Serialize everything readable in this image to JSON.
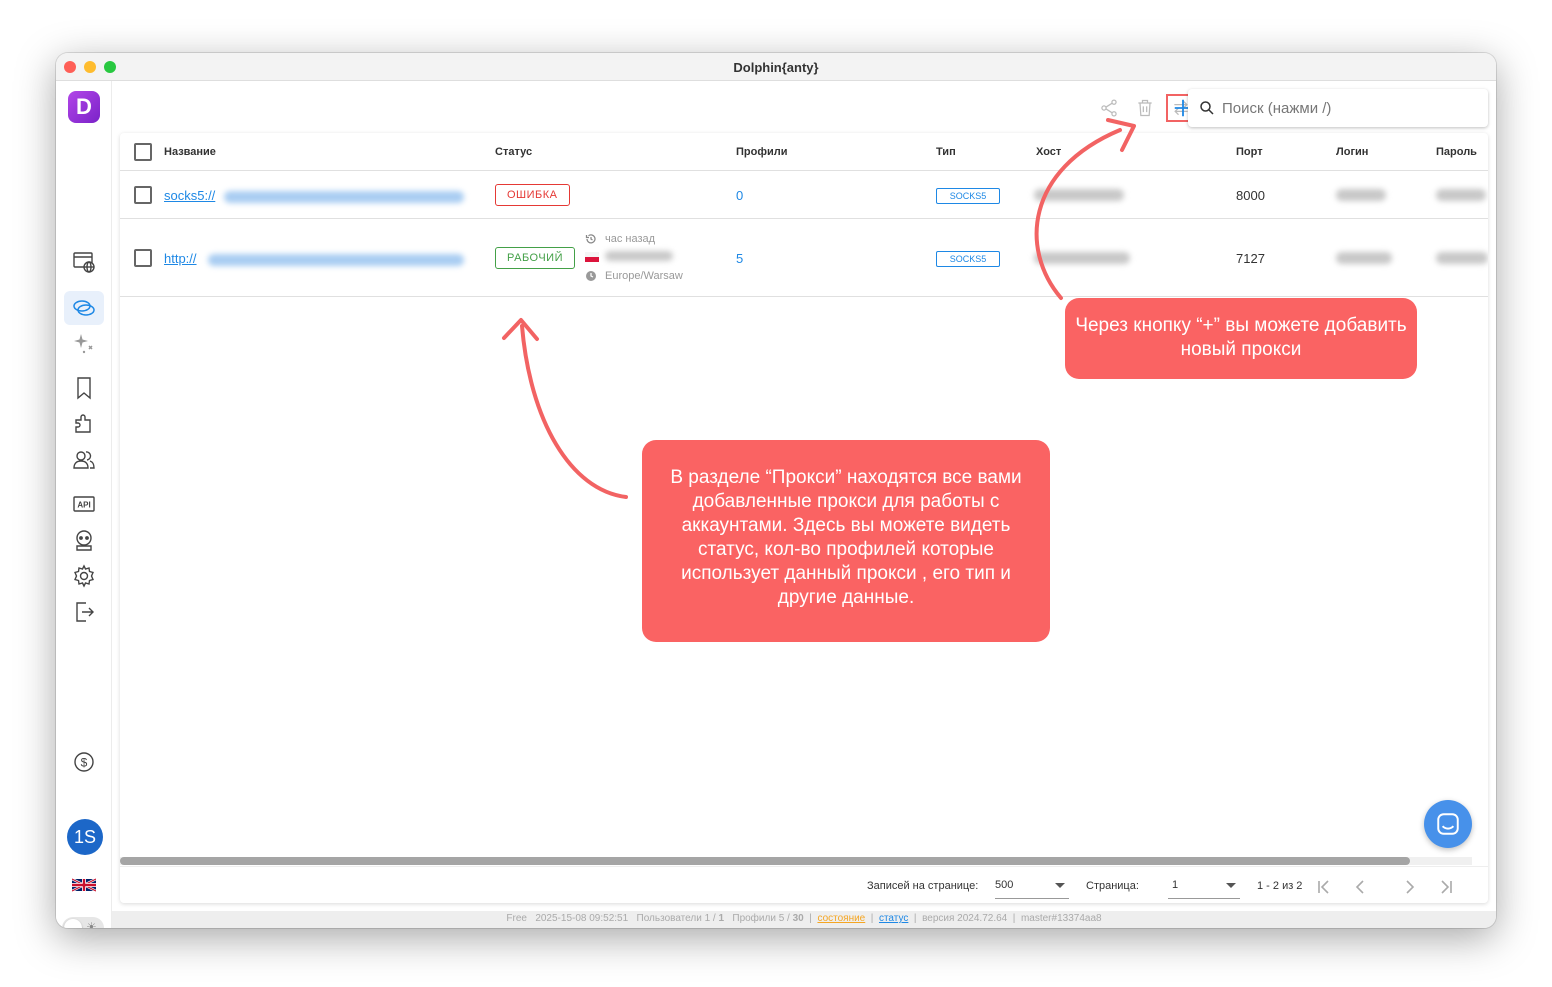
{
  "window": {
    "title": "Dolphin{anty}"
  },
  "sidebar": {
    "logo": "D",
    "avatar": "1S"
  },
  "search": {
    "placeholder": "Поиск (нажми /)"
  },
  "table": {
    "columns": [
      "Название",
      "Статус",
      "Профили",
      "Тип",
      "Хост",
      "Порт",
      "Логин",
      "Пароль"
    ],
    "rows": [
      {
        "name": "socks5://",
        "status": "ОШИБКА",
        "profiles": "0",
        "type": "SOCKS5",
        "port": "8000"
      },
      {
        "name": "http://",
        "status": "РАБОЧИЙ",
        "checked": "час назад",
        "timezone": "Europe/Warsaw",
        "profiles": "5",
        "type": "SOCKS5",
        "port": "7127"
      }
    ]
  },
  "pagination": {
    "per_page_label": "Записей на странице:",
    "per_page": "500",
    "page_label": "Страница:",
    "page": "1",
    "range": "1 - 2 из 2"
  },
  "statusbar": {
    "plan": "Free",
    "datetime": "2025-15-08 09:52:51",
    "users": "Пользователи 1 /",
    "users_max": "1",
    "profiles": "Профили 5 /",
    "profiles_max": "30",
    "state_link": "состояние",
    "status_link": "статус",
    "version": "версия 2024.72.64",
    "build": "master#13374aa8"
  },
  "callouts": {
    "plus": "Через кнопку “+” вы можете добавить новый прокси",
    "section": "В разделе “Прокси” находятся все вами добавленные прокси для работы с аккаунтами. Здесь вы можете видеть статус, кол-во профилей которые использует данный прокси , его тип и другие данные."
  },
  "colors": {
    "accent": "#1e88e5",
    "callout": "#fa6363",
    "error": "#e53935",
    "ok": "#43a047"
  }
}
